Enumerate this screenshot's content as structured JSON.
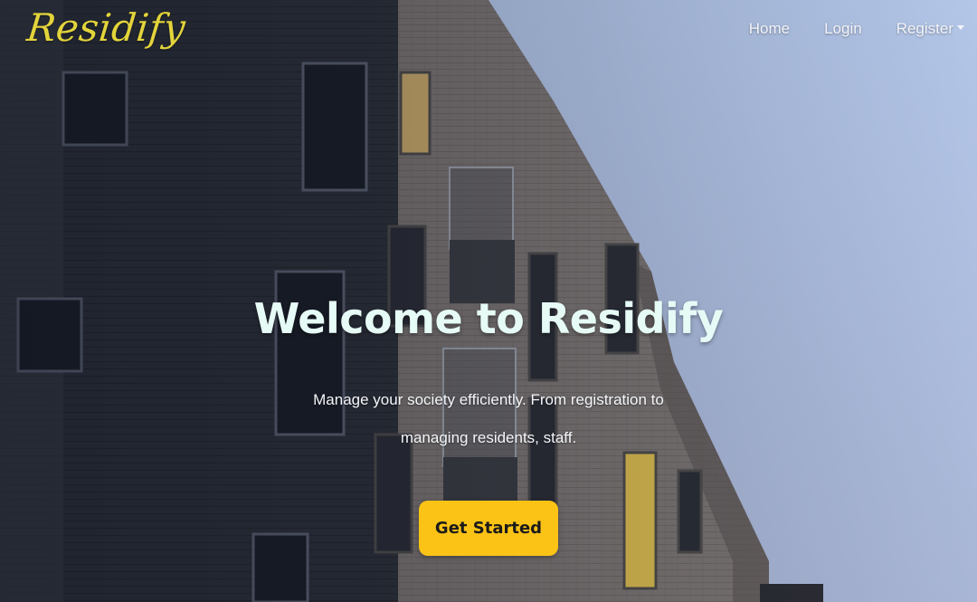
{
  "navbar": {
    "brand": "Residify",
    "links": {
      "home": "Home",
      "login": "Login",
      "register": "Register"
    }
  },
  "hero": {
    "title": "Welcome to Residify",
    "subtitle": "Manage your society efficiently. From registration to managing residents, staff.",
    "cta_label": "Get Started"
  },
  "colors": {
    "brand": "#e3d43b",
    "cta": "#fbc315",
    "title": "#e6fbf6"
  },
  "icons": {
    "register_dropdown": "caret-down-icon"
  }
}
